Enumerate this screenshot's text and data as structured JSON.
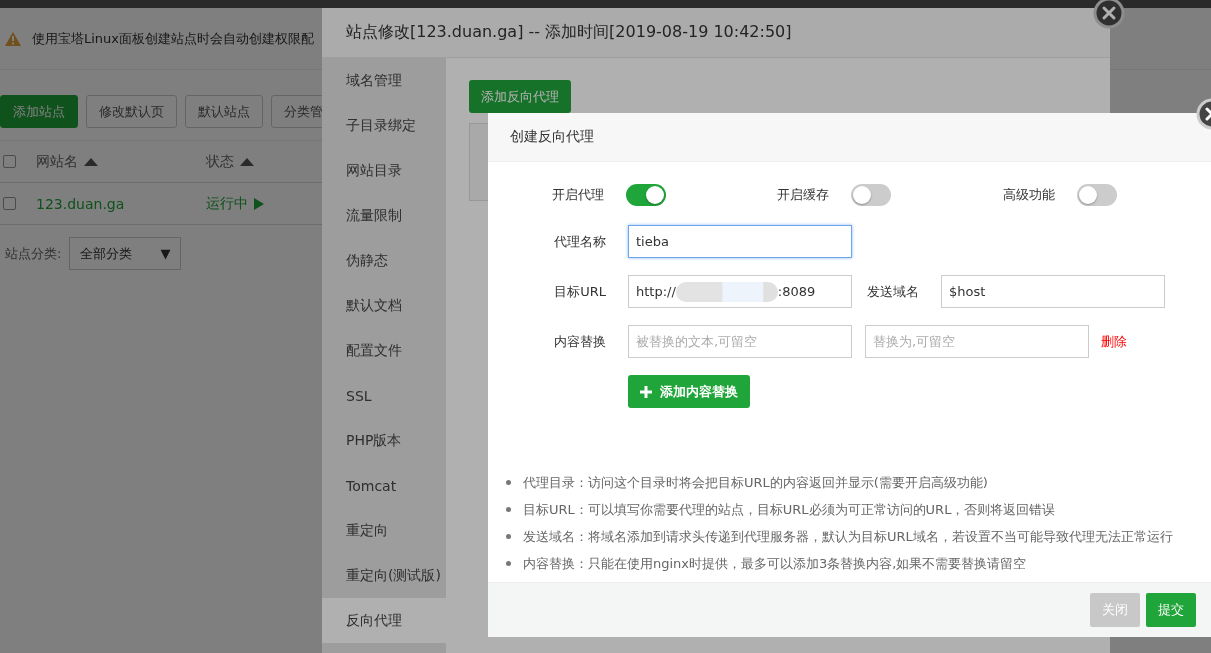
{
  "page": {
    "notice": "使用宝塔Linux面板创建站点时会自动创建权限配",
    "toolbar": [
      {
        "label": "添加站点",
        "primary": true
      },
      {
        "label": "修改默认页",
        "primary": false
      },
      {
        "label": "默认站点",
        "primary": false
      },
      {
        "label": "分类管",
        "primary": false
      }
    ],
    "table": {
      "header_checked": false,
      "columns": [
        "网站名",
        "状态"
      ],
      "rows": [
        {
          "checked": false,
          "name": "123.duan.ga",
          "status": "运行中"
        }
      ]
    },
    "category": {
      "label": "站点分类:",
      "value": "全部分类",
      "caret": "▼"
    }
  },
  "site_dialog": {
    "title": "站点修改[123.duan.ga] -- 添加时间[2019-08-19 10:42:50]",
    "menu": [
      {
        "label": "域名管理",
        "selected": false
      },
      {
        "label": "子目录绑定",
        "selected": false
      },
      {
        "label": "网站目录",
        "selected": false
      },
      {
        "label": "流量限制",
        "selected": false
      },
      {
        "label": "伪静态",
        "selected": false
      },
      {
        "label": "默认文档",
        "selected": false
      },
      {
        "label": "配置文件",
        "selected": false
      },
      {
        "label": "SSL",
        "selected": false
      },
      {
        "label": "PHP版本",
        "selected": false
      },
      {
        "label": "Tomcat",
        "selected": false
      },
      {
        "label": "重定向",
        "selected": false
      },
      {
        "label": "重定向(测试版)",
        "selected": false
      },
      {
        "label": "反向代理",
        "selected": true
      }
    ],
    "add_button": "添加反向代理"
  },
  "proxy_dialog": {
    "title": "创建反向代理",
    "switches": [
      {
        "label": "开启代理",
        "on": true
      },
      {
        "label": "开启缓存",
        "on": false
      },
      {
        "label": "高级功能",
        "on": false
      }
    ],
    "name_label": "代理名称",
    "name_value": "tieba",
    "url_label": "目标URL",
    "url_prefix": "http://",
    "url_suffix": ":8089",
    "host_label": "发送域名",
    "host_value": "$host",
    "replace_label": "内容替换",
    "replace_from_placeholder": "被替换的文本,可留空",
    "replace_to_placeholder": "替换为,可留空",
    "delete_link": "删除",
    "add_replace_button": "添加内容替换",
    "notes": [
      "代理目录：访问这个目录时将会把目标URL的内容返回并显示(需要开启高级功能)",
      "目标URL：可以填写你需要代理的站点，目标URL必须为可正常访问的URL，否则将返回错误",
      "发送域名：将域名添加到请求头传递到代理服务器，默认为目标URL域名，若设置不当可能导致代理无法正常运行",
      "内容替换：只能在使用nginx时提供，最多可以添加3条替换内容,如果不需要替换请留空"
    ],
    "buttons": [
      {
        "label": "关闭",
        "primary": false
      },
      {
        "label": "提交",
        "primary": true
      }
    ]
  }
}
